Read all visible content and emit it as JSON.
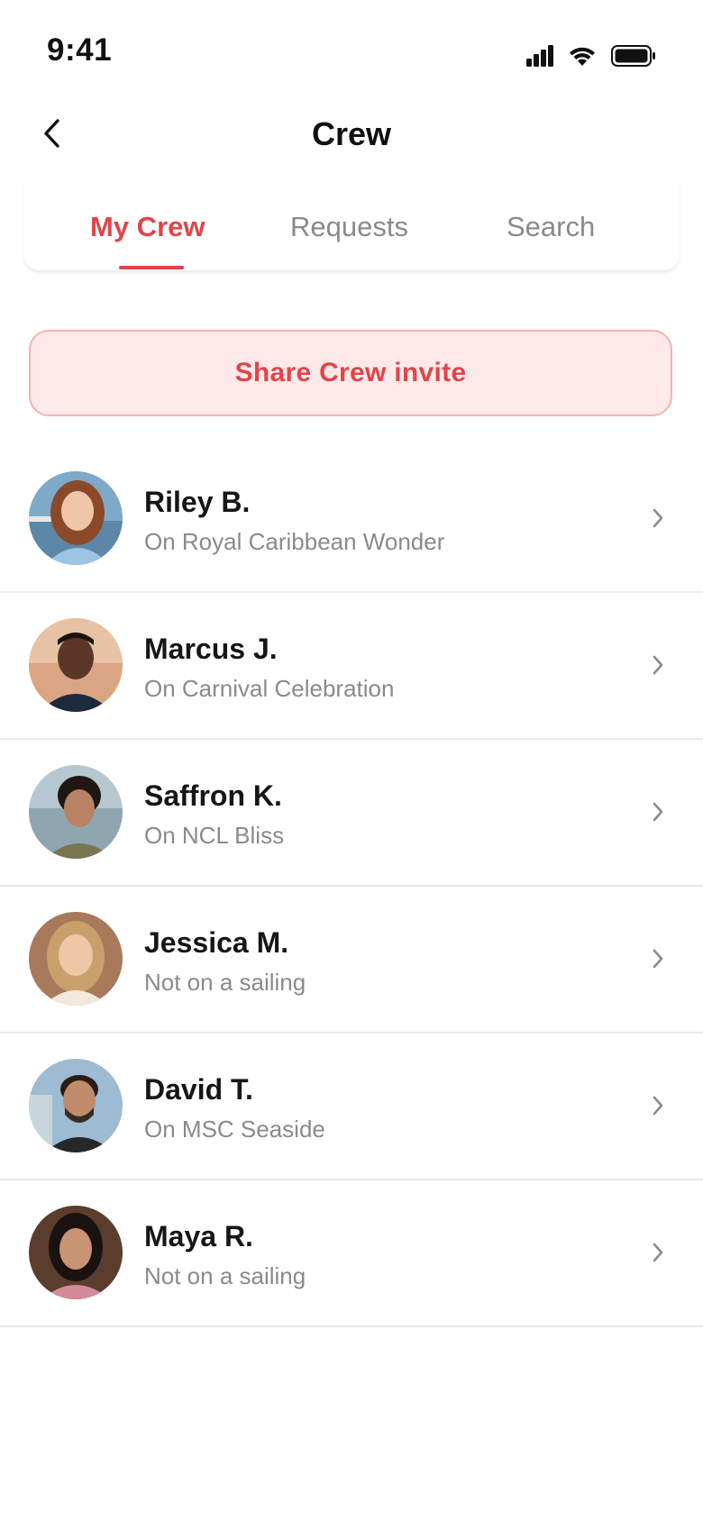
{
  "status_bar": {
    "time": "9:41",
    "icons": [
      "cellular-signal-icon",
      "wifi-icon",
      "battery-icon"
    ]
  },
  "header": {
    "title": "Crew",
    "back_icon": "chevron-left-icon"
  },
  "tabs": [
    {
      "label": "My Crew",
      "active": true
    },
    {
      "label": "Requests",
      "active": false
    },
    {
      "label": "Search",
      "active": false
    }
  ],
  "invite": {
    "label": "Share Crew invite"
  },
  "crew": [
    {
      "name": "Riley B.",
      "status": "On Royal Caribbean Wonder"
    },
    {
      "name": "Marcus J.",
      "status": "On Carnival Celebration"
    },
    {
      "name": "Saffron K.",
      "status": "On NCL Bliss"
    },
    {
      "name": "Jessica M.",
      "status": "Not on a sailing"
    },
    {
      "name": "David T.",
      "status": "On MSC Seaside"
    },
    {
      "name": "Maya R.",
      "status": "Not on a sailing"
    }
  ],
  "colors": {
    "accent": "#e0454a",
    "invite_bg": "#fde9e9",
    "invite_border": "#f2b3b3",
    "muted_text": "#8a8a8e",
    "divider": "#e9e9ea"
  }
}
